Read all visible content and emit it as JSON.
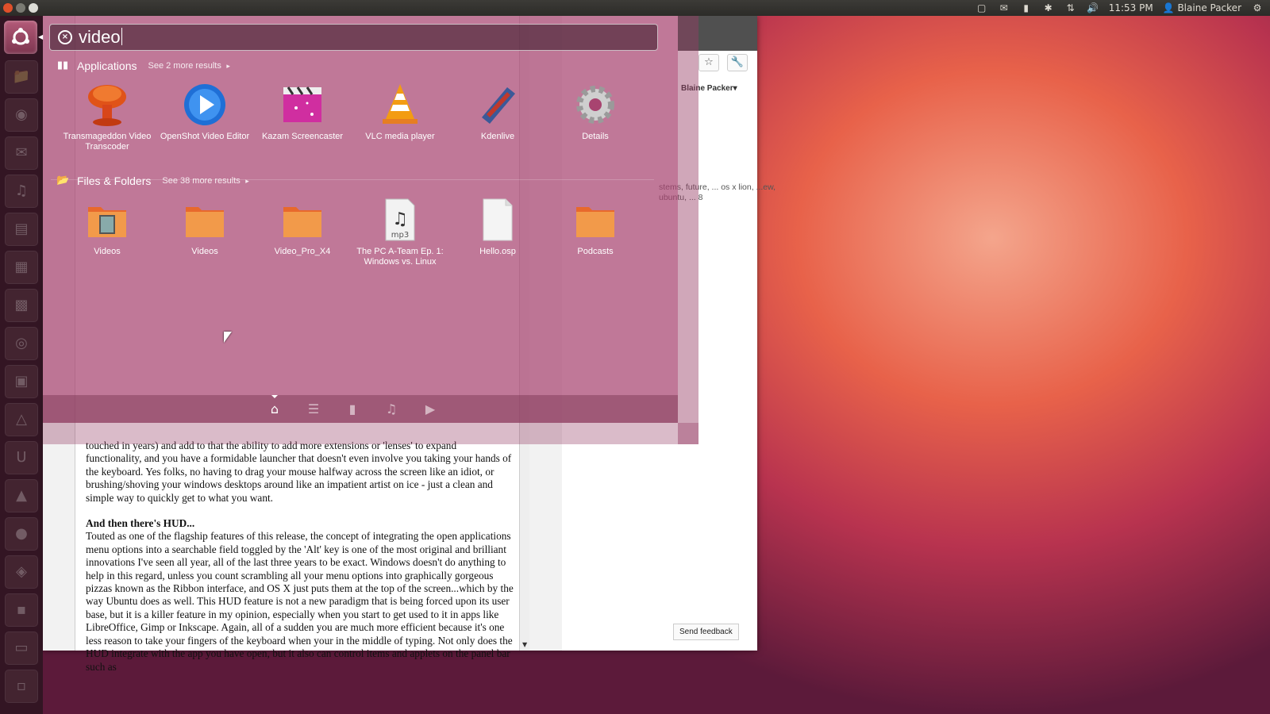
{
  "panel": {
    "time": "11:53 PM",
    "user": "Blaine Packer"
  },
  "dash": {
    "search_query": "video",
    "applications": {
      "title": "Applications",
      "more": "See 2 more results",
      "items": [
        {
          "label": "Transmageddon Video Transcoder",
          "icon": "mushroom-cloud-icon"
        },
        {
          "label": "OpenShot Video Editor",
          "icon": "openshot-play-icon"
        },
        {
          "label": "Kazam Screencaster",
          "icon": "kazam-clapper-icon"
        },
        {
          "label": "VLC media player",
          "icon": "vlc-cone-icon"
        },
        {
          "label": "Kdenlive",
          "icon": "kdenlive-icon"
        },
        {
          "label": "Details",
          "icon": "gear-icon"
        }
      ]
    },
    "files": {
      "title": "Files & Folders",
      "more": "See 38 more results",
      "items": [
        {
          "label": "Videos",
          "icon": "video-folder-icon"
        },
        {
          "label": "Videos",
          "icon": "folder-icon"
        },
        {
          "label": "Video_Pro_X4",
          "icon": "folder-icon"
        },
        {
          "label": "The PC A-Team Ep. 1: Windows vs. Linux",
          "icon": "mp3-file-icon"
        },
        {
          "label": "Hello.osp",
          "icon": "document-icon"
        },
        {
          "label": "Podcasts",
          "icon": "folder-icon"
        }
      ]
    }
  },
  "browser": {
    "user_menu": "Blaine Packer",
    "sidebar_snippet": "stems, future, ... os x lion, ...ew, ubuntu, ... 8",
    "feedback": "Send feedback",
    "article": {
      "para1": "touched in years) and add to that the ability to add more extensions or 'lenses' to expand functionality, and you have a formidable launcher that doesn't even involve you taking your hands of the keyboard. Yes folks, no having to drag your mouse halfway across the screen like an idiot, or brushing/shoving your windows desktops around like an impatient artist on ice - just a clean and simple way to quickly get to what you want.",
      "heading": "And then there's HUD...",
      "para2": "Touted as one of the flagship features of this release, the concept of integrating the open applications menu options into a searchable field toggled by the 'Alt' key is one of the most original and brilliant innovations I've seen all year, all of the last three years to be exact. Windows doesn't do anything to help in this regard, unless you count scrambling all your menu options into graphically gorgeous pizzas known as the Ribbon interface, and OS X just puts them at the top of the screen...which by the way Ubuntu does as well. This HUD feature is not a new paradigm that is being forced upon its user base, but it is a killer feature in my opinion, especially when you start to get used to it in apps like LibreOffice, Gimp or Inkscape. Again, all of a sudden you are much more efficient because it's one less reason to take your fingers of the keyboard when your in the middle of typing. Not only does the HUD integrate with the app you have open, but it also can control items and applets on the panel bar such as"
    }
  },
  "colors": {
    "dash_tint": "#a84470",
    "panel_bg": "#3c3b37"
  }
}
